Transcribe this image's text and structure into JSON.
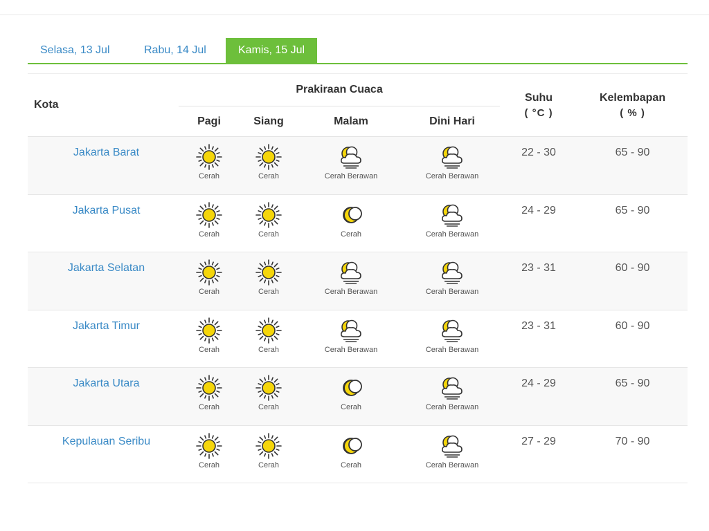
{
  "tabs": [
    {
      "label": "Selasa, 13 Jul",
      "active": false
    },
    {
      "label": "Rabu, 14 Jul",
      "active": false
    },
    {
      "label": "Kamis, 15 Jul",
      "active": true
    }
  ],
  "colors": {
    "accent": "#6dbf3b",
    "link": "#3a8ac6"
  },
  "table": {
    "headers": {
      "city": "Kota",
      "forecast": "Prakiraan Cuaca",
      "morning": "Pagi",
      "noon": "Siang",
      "evening": "Malam",
      "dawn": "Dini Hari",
      "temp": "Suhu",
      "temp_unit": "( °C )",
      "humidity": "Kelembapan",
      "humidity_unit": "( % )"
    },
    "rows": [
      {
        "city": "Jakarta Barat",
        "morning": {
          "icon": "sun-icon",
          "label": "Cerah"
        },
        "noon": {
          "icon": "sun-icon",
          "label": "Cerah"
        },
        "evening": {
          "icon": "moon-cloud-icon",
          "label": "Cerah Berawan"
        },
        "dawn": {
          "icon": "moon-cloud-icon",
          "label": "Cerah Berawan"
        },
        "temp": "22 - 30",
        "humidity": "65 - 90"
      },
      {
        "city": "Jakarta Pusat",
        "morning": {
          "icon": "sun-icon",
          "label": "Cerah"
        },
        "noon": {
          "icon": "sun-icon",
          "label": "Cerah"
        },
        "evening": {
          "icon": "moon-icon",
          "label": "Cerah"
        },
        "dawn": {
          "icon": "moon-cloud-icon",
          "label": "Cerah Berawan"
        },
        "temp": "24 - 29",
        "humidity": "65 - 90"
      },
      {
        "city": "Jakarta Selatan",
        "morning": {
          "icon": "sun-icon",
          "label": "Cerah"
        },
        "noon": {
          "icon": "sun-icon",
          "label": "Cerah"
        },
        "evening": {
          "icon": "moon-cloud-icon",
          "label": "Cerah Berawan"
        },
        "dawn": {
          "icon": "moon-cloud-icon",
          "label": "Cerah Berawan"
        },
        "temp": "23 - 31",
        "humidity": "60 - 90"
      },
      {
        "city": "Jakarta Timur",
        "morning": {
          "icon": "sun-icon",
          "label": "Cerah"
        },
        "noon": {
          "icon": "sun-icon",
          "label": "Cerah"
        },
        "evening": {
          "icon": "moon-cloud-icon",
          "label": "Cerah Berawan"
        },
        "dawn": {
          "icon": "moon-cloud-icon",
          "label": "Cerah Berawan"
        },
        "temp": "23 - 31",
        "humidity": "60 - 90"
      },
      {
        "city": "Jakarta Utara",
        "morning": {
          "icon": "sun-icon",
          "label": "Cerah"
        },
        "noon": {
          "icon": "sun-icon",
          "label": "Cerah"
        },
        "evening": {
          "icon": "moon-icon",
          "label": "Cerah"
        },
        "dawn": {
          "icon": "moon-cloud-icon",
          "label": "Cerah Berawan"
        },
        "temp": "24 - 29",
        "humidity": "65 - 90"
      },
      {
        "city": "Kepulauan Seribu",
        "morning": {
          "icon": "sun-icon",
          "label": "Cerah"
        },
        "noon": {
          "icon": "sun-icon",
          "label": "Cerah"
        },
        "evening": {
          "icon": "moon-icon",
          "label": "Cerah"
        },
        "dawn": {
          "icon": "moon-cloud-icon",
          "label": "Cerah Berawan"
        },
        "temp": "27 - 29",
        "humidity": "70 - 90"
      }
    ]
  }
}
